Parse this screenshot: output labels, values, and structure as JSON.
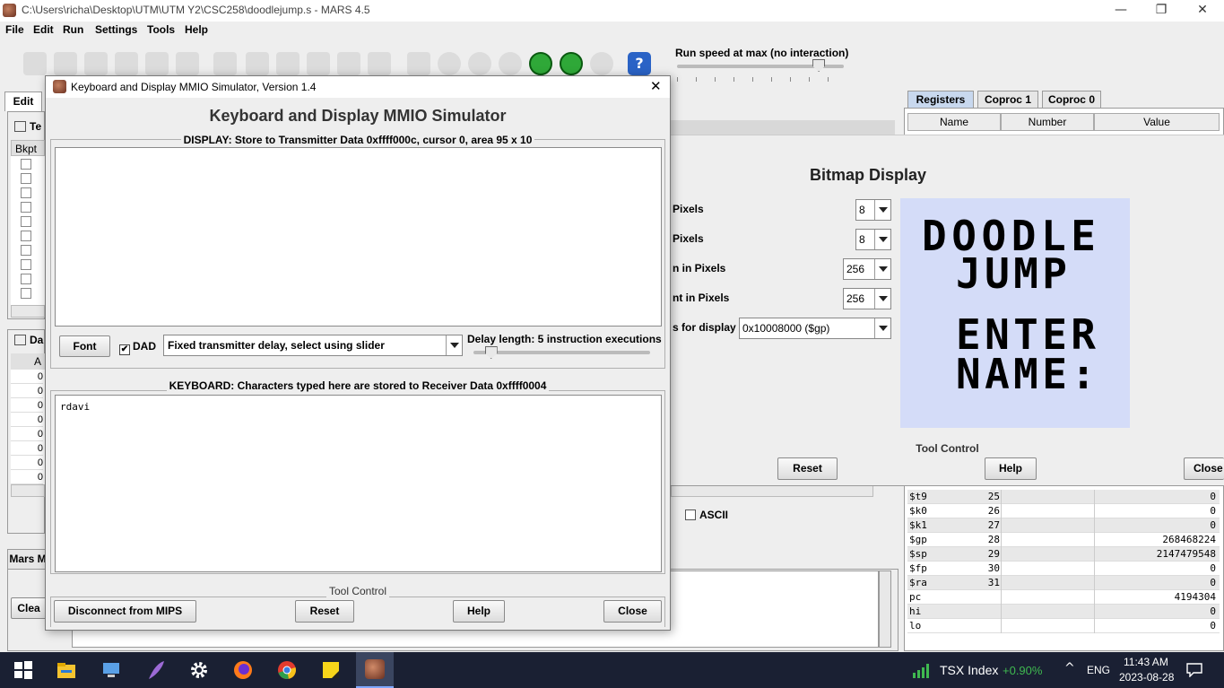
{
  "window": {
    "title": "C:\\Users\\richa\\Desktop\\UTM\\UTM Y2\\CSC258\\doodlejump.s  - MARS 4.5",
    "controls": {
      "minimize": "—",
      "restore": "❐",
      "close": "✕"
    }
  },
  "menu": {
    "file": "File",
    "edit": "Edit",
    "run": "Run",
    "settings": "Settings",
    "tools": "Tools",
    "help": "Help"
  },
  "toolbar": {
    "help_glyph": "?"
  },
  "run_speed": {
    "label": "Run speed at max (no interaction)",
    "fraction": 0.85
  },
  "main": {
    "edit_tab": "Edit",
    "text_tab": "Te",
    "bkpt_header": "Bkpt",
    "data_tab": "Da",
    "address_header": "A",
    "data_cells": [
      "0",
      "0",
      "0",
      "0",
      "0",
      "0",
      "0",
      "0"
    ],
    "ascii_label": "ASCII",
    "mars_tab": "Mars M",
    "clear_button": "Clea"
  },
  "registers": {
    "tabs": [
      "Registers",
      "Coproc 1",
      "Coproc 0"
    ],
    "headers": [
      "Name",
      "Number",
      "Value"
    ],
    "rows": [
      {
        "name": "$t9",
        "number": "25",
        "value": "0"
      },
      {
        "name": "$k0",
        "number": "26",
        "value": "0"
      },
      {
        "name": "$k1",
        "number": "27",
        "value": "0"
      },
      {
        "name": "$gp",
        "number": "28",
        "value": "268468224"
      },
      {
        "name": "$sp",
        "number": "29",
        "value": "2147479548"
      },
      {
        "name": "$fp",
        "number": "30",
        "value": "0"
      },
      {
        "name": "$ra",
        "number": "31",
        "value": "0"
      },
      {
        "name": "pc",
        "number": "",
        "value": "4194304"
      },
      {
        "name": "hi",
        "number": "",
        "value": "0"
      },
      {
        "name": "lo",
        "number": "",
        "value": "0"
      }
    ]
  },
  "bitmap": {
    "title": "Bitmap Display",
    "settings": [
      {
        "label": "Pixels",
        "value": "8"
      },
      {
        "label": "Pixels",
        "value": "8"
      },
      {
        "label": "n in Pixels",
        "value": "256"
      },
      {
        "label": "nt in Pixels",
        "value": "256"
      },
      {
        "label": "s for display",
        "value": "0x10008000 ($gp)"
      }
    ],
    "canvas_text": [
      "DOODLE",
      "JUMP",
      "ENTER",
      "NAME:"
    ],
    "canvas_color": "#d4dcf8",
    "tool_control": "Tool Control",
    "reset": "Reset",
    "help": "Help",
    "close": "Close"
  },
  "mmio": {
    "window_title": "Keyboard and Display MMIO Simulator, Version 1.4",
    "heading": "Keyboard and Display MMIO Simulator",
    "display_label": "DISPLAY: Store to Transmitter Data 0xffff000c, cursor 0, area 95 x 10",
    "display_text": "",
    "font_button": "Font",
    "dad_label": "DAD",
    "dad_checked": true,
    "delay_mode": "Fixed transmitter delay, select using slider",
    "delay_label": "Delay length: 5 instruction executions",
    "delay_fraction": 0.1,
    "keyboard_label": "KEYBOARD: Characters typed here are stored to Receiver Data 0xffff0004",
    "keyboard_text": "rdavi",
    "tool_control": "Tool Control",
    "disconnect": "Disconnect from MIPS",
    "reset": "Reset",
    "help": "Help",
    "close": "Close"
  },
  "taskbar": {
    "stock_name": "TSX Index",
    "stock_change": "+0.90%",
    "language": "ENG",
    "time": "11:43 AM",
    "date": "2023-08-28",
    "accent": "#3fb950"
  }
}
